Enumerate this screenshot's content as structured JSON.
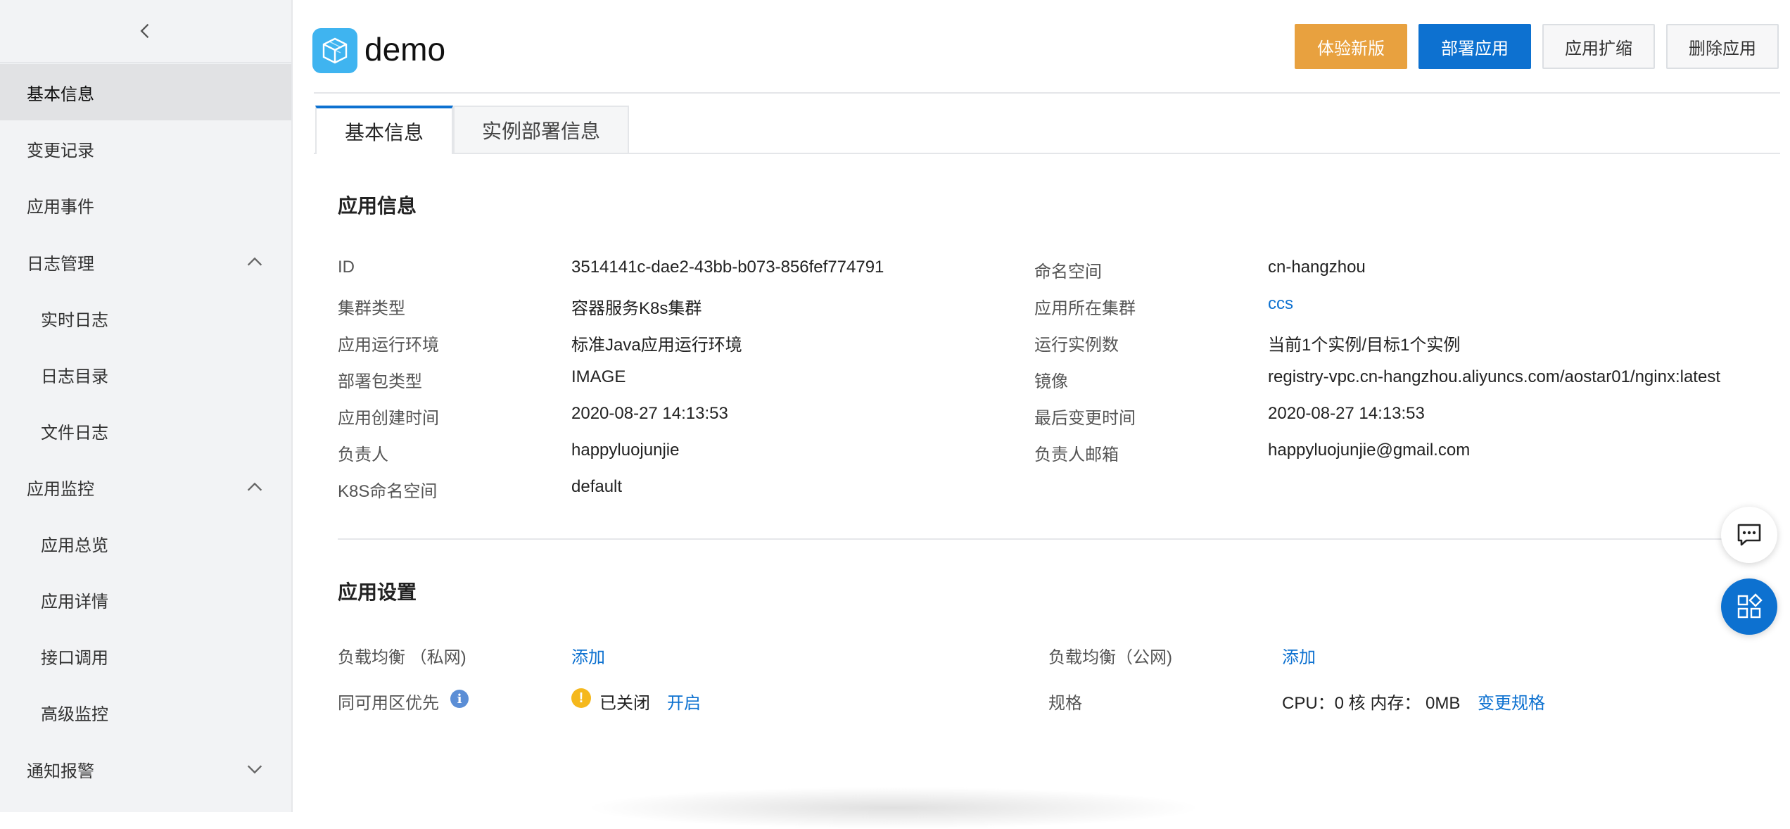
{
  "sidebar": {
    "items": [
      {
        "label": "基本信息"
      },
      {
        "label": "变更记录"
      },
      {
        "label": "应用事件"
      },
      {
        "label": "日志管理"
      },
      {
        "label": "实时日志"
      },
      {
        "label": "日志目录"
      },
      {
        "label": "文件日志"
      },
      {
        "label": "应用监控"
      },
      {
        "label": "应用总览"
      },
      {
        "label": "应用详情"
      },
      {
        "label": "接口调用"
      },
      {
        "label": "高级监控"
      },
      {
        "label": "通知报警"
      }
    ]
  },
  "header": {
    "title": "demo",
    "buttons": {
      "try_new": "体验新版",
      "deploy": "部署应用",
      "scale": "应用扩缩",
      "delete": "删除应用"
    }
  },
  "tabs": [
    {
      "label": "基本信息"
    },
    {
      "label": "实例部署信息"
    }
  ],
  "app_info": {
    "title": "应用信息",
    "left": [
      {
        "label": "ID",
        "value": "3514141c-dae2-43bb-b073-856fef774791"
      },
      {
        "label": "集群类型",
        "value": "容器服务K8s集群"
      },
      {
        "label": "应用运行环境",
        "value": "标准Java应用运行环境"
      },
      {
        "label": "部署包类型",
        "value": "IMAGE"
      },
      {
        "label": "应用创建时间",
        "value": "2020-08-27 14:13:53"
      },
      {
        "label": "负责人",
        "value": "happyluojunjie"
      },
      {
        "label": "K8S命名空间",
        "value": "default"
      }
    ],
    "right": [
      {
        "label": "命名空间",
        "value": "cn-hangzhou"
      },
      {
        "label": "应用所在集群",
        "value": "ccs"
      },
      {
        "label": "运行实例数",
        "value": "当前1个实例/目标1个实例"
      },
      {
        "label": "镜像",
        "value": "registry-vpc.cn-hangzhou.aliyuncs.com/aostar01/nginx:latest"
      },
      {
        "label": "最后变更时间",
        "value": "2020-08-27 14:13:53"
      },
      {
        "label": "负责人邮箱",
        "value": "happyluojunjie@gmail.com"
      }
    ]
  },
  "app_settings": {
    "title": "应用设置",
    "slb_private_label": "负载均衡 （私网)",
    "slb_private_action": "添加",
    "slb_public_label": "负载均衡（公网)",
    "slb_public_action": "添加",
    "zone_priority_label": "同可用区优先",
    "zone_priority_status": "已关闭",
    "zone_priority_action": "开启",
    "spec_label": "规格",
    "spec_value": "CPU：0 核 内存： 0MB",
    "spec_action": "变更规格"
  },
  "colors": {
    "accent": "#0d71d0",
    "orange": "#e8a13f",
    "warning": "#f5b81c",
    "logo": "#3fb4f0"
  }
}
